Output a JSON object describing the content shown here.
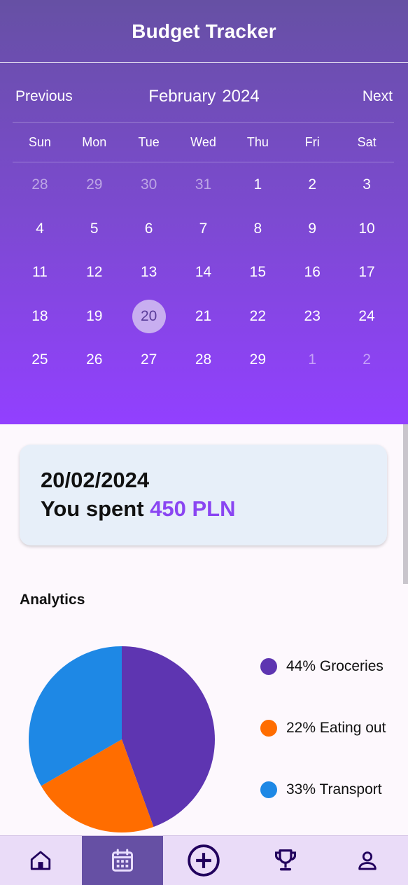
{
  "app": {
    "title": "Budget Tracker"
  },
  "calendar": {
    "prev_label": "Previous",
    "next_label": "Next",
    "month": "February",
    "year": "2024",
    "weekdays": [
      "Sun",
      "Mon",
      "Tue",
      "Wed",
      "Thu",
      "Fri",
      "Sat"
    ],
    "days": [
      {
        "label": "28",
        "muted": true
      },
      {
        "label": "29",
        "muted": true
      },
      {
        "label": "30",
        "muted": true
      },
      {
        "label": "31",
        "muted": true
      },
      {
        "label": "1"
      },
      {
        "label": "2"
      },
      {
        "label": "3"
      },
      {
        "label": "4"
      },
      {
        "label": "5"
      },
      {
        "label": "6"
      },
      {
        "label": "7"
      },
      {
        "label": "8"
      },
      {
        "label": "9"
      },
      {
        "label": "10"
      },
      {
        "label": "11"
      },
      {
        "label": "12"
      },
      {
        "label": "13"
      },
      {
        "label": "14"
      },
      {
        "label": "15"
      },
      {
        "label": "16"
      },
      {
        "label": "17"
      },
      {
        "label": "18"
      },
      {
        "label": "19"
      },
      {
        "label": "20",
        "selected": true
      },
      {
        "label": "21"
      },
      {
        "label": "22"
      },
      {
        "label": "23"
      },
      {
        "label": "24"
      },
      {
        "label": "25"
      },
      {
        "label": "26"
      },
      {
        "label": "27"
      },
      {
        "label": "28"
      },
      {
        "label": "29"
      },
      {
        "label": "1",
        "muted": true
      },
      {
        "label": "2",
        "muted": true
      }
    ]
  },
  "summary": {
    "date": "20/02/2024",
    "spent_prefix": "You spent",
    "amount": "450 PLN"
  },
  "analytics": {
    "title": "Analytics",
    "legend": [
      {
        "label": "44% Groceries",
        "color": "#5e35b1"
      },
      {
        "label": "22% Eating out",
        "color": "#ff6d00"
      },
      {
        "label": "33% Transport",
        "color": "#1e88e5"
      }
    ]
  },
  "chart_data": {
    "type": "pie",
    "categories": [
      "Groceries",
      "Eating out",
      "Transport"
    ],
    "values": [
      44,
      22,
      33
    ],
    "colors": [
      "#5e35b1",
      "#ff6d00",
      "#1e88e5"
    ],
    "start_angle": "12 o'clock",
    "direction": "clockwise",
    "legend": "right"
  },
  "bottom_nav": {
    "items": [
      {
        "icon": "home-icon",
        "active": false
      },
      {
        "icon": "calendar-icon",
        "active": true
      },
      {
        "icon": "add-circle-icon",
        "active": false
      },
      {
        "icon": "trophy-icon",
        "active": false
      },
      {
        "icon": "person-icon",
        "active": false
      }
    ]
  }
}
